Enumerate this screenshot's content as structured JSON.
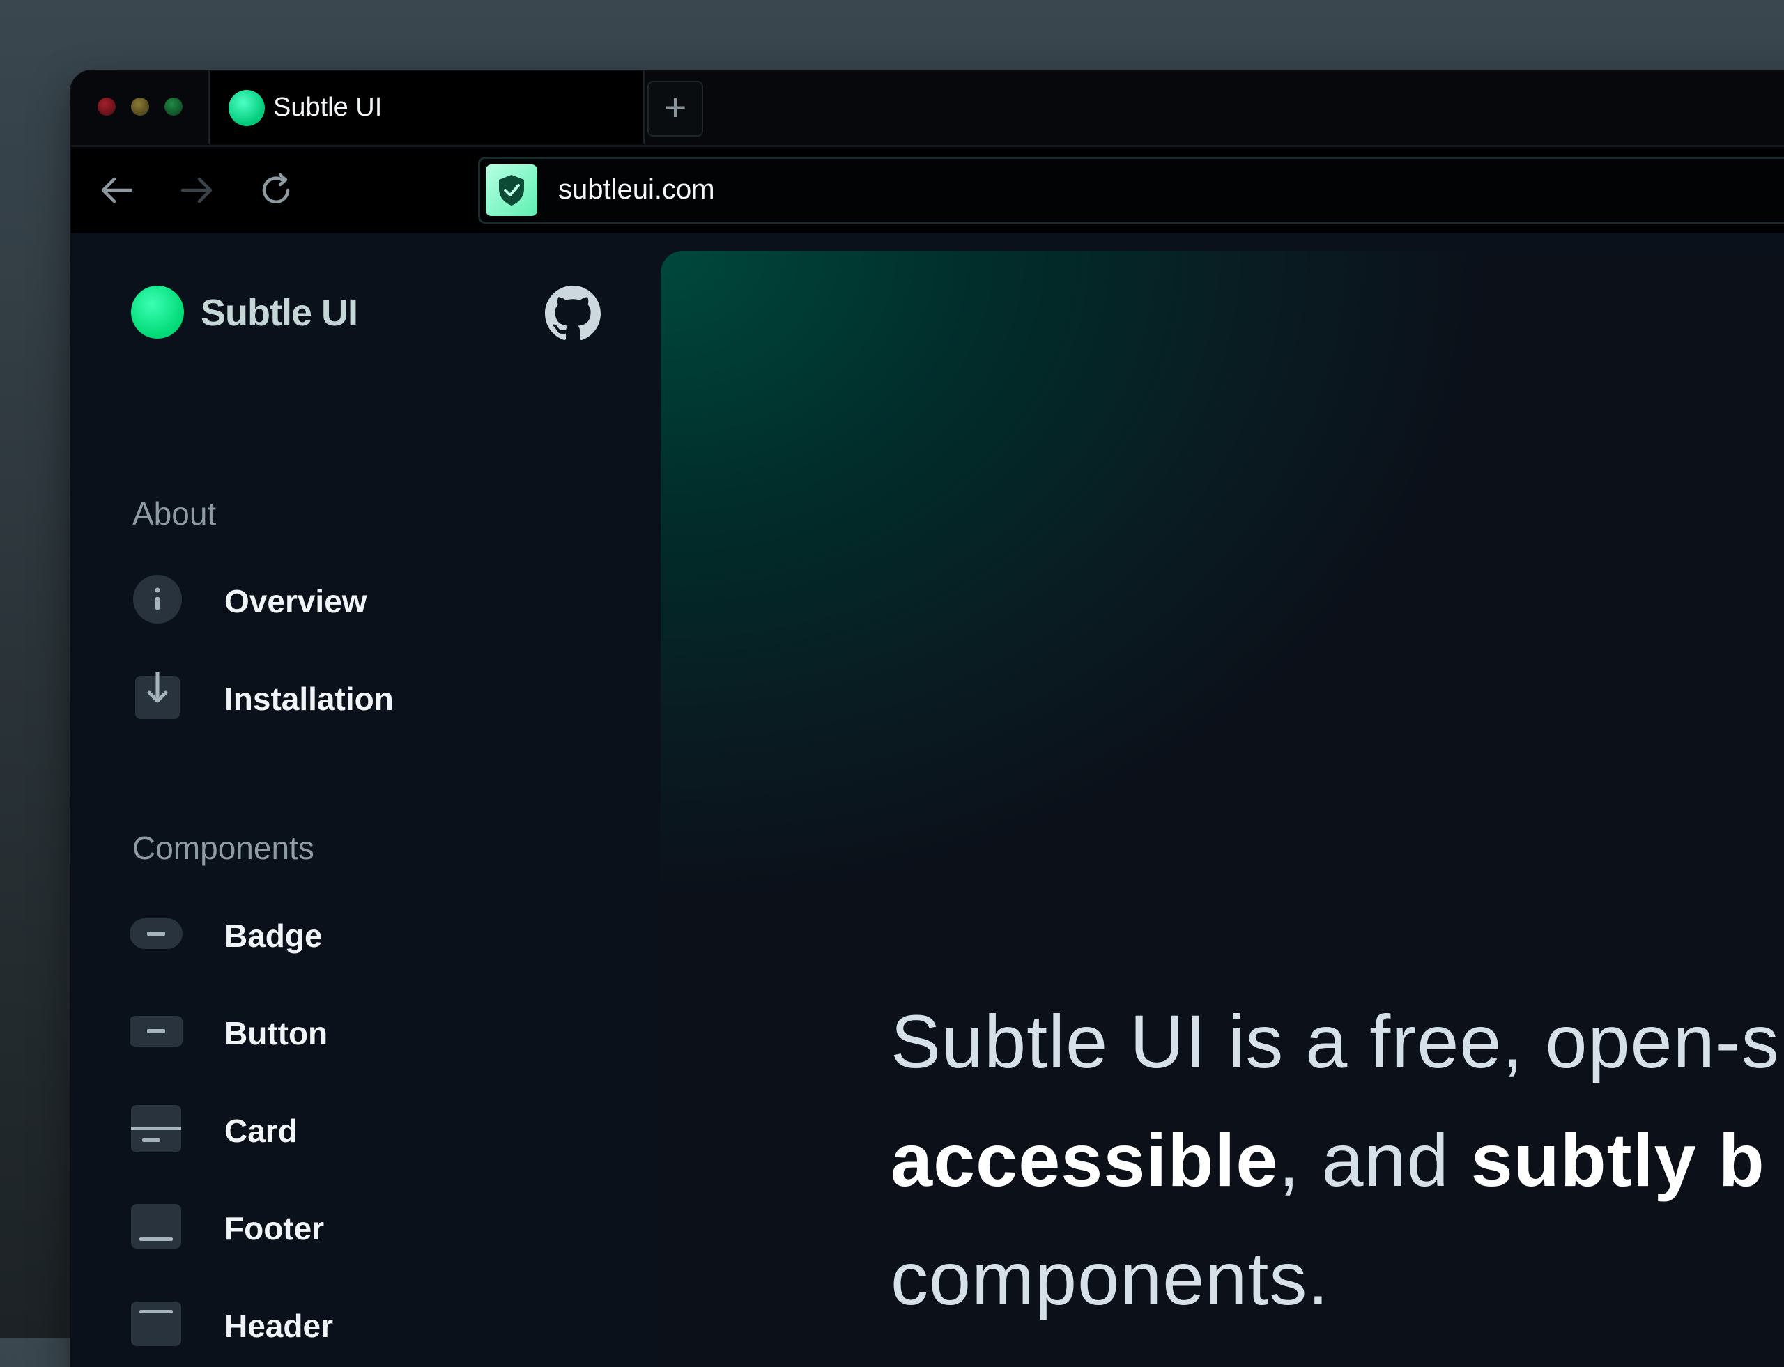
{
  "browser": {
    "tab": {
      "title": "Subtle UI",
      "new_tab_label": "+"
    },
    "url": "subtleui.com"
  },
  "sidebar": {
    "brand": "Subtle UI",
    "sections": [
      {
        "label": "About",
        "items": [
          {
            "label": "Overview",
            "icon": "info-icon"
          },
          {
            "label": "Installation",
            "icon": "download-icon"
          }
        ]
      },
      {
        "label": "Components",
        "items": [
          {
            "label": "Badge",
            "icon": "badge-icon"
          },
          {
            "label": "Button",
            "icon": "button-icon"
          },
          {
            "label": "Card",
            "icon": "card-icon"
          },
          {
            "label": "Footer",
            "icon": "footer-icon"
          },
          {
            "label": "Header",
            "icon": "header-icon"
          }
        ]
      }
    ]
  },
  "hero": {
    "line1": "Subtle UI is a free, open-s",
    "bold1": "accessible",
    "mid": ", and ",
    "bold2": "subtly b",
    "line3": "components."
  },
  "colors": {
    "accent": "#00d975",
    "page_bg": "#0b111b",
    "hero_glow": "#00483c"
  }
}
